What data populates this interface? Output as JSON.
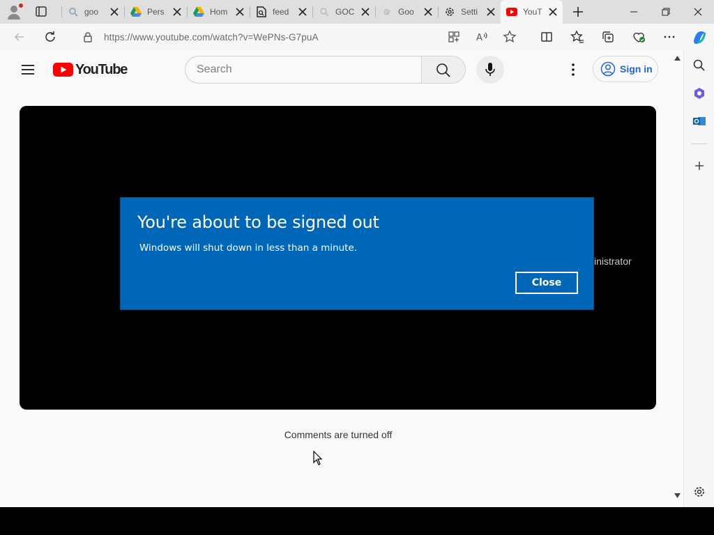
{
  "browser": {
    "tabs": [
      {
        "title": "goo",
        "icon": "google-search-icon"
      },
      {
        "title": "Pers",
        "icon": "google-drive-icon"
      },
      {
        "title": "Hom",
        "icon": "google-drive-icon"
      },
      {
        "title": "feed",
        "icon": "document-search-icon"
      },
      {
        "title": "GOC",
        "icon": "search-icon"
      },
      {
        "title": "Goo",
        "icon": "google-icon"
      },
      {
        "title": "Setti",
        "icon": "gear-icon"
      },
      {
        "title": "YouT",
        "icon": "youtube-icon",
        "active": true
      }
    ],
    "url": "https://www.youtube.com/watch?v=WePNs-G7puA"
  },
  "youtube": {
    "logo_text": "YouTube",
    "search_placeholder": "Search",
    "signin_label": "Sign in",
    "brand_red": "#ff0000",
    "partial_text": "inistrator",
    "comments_text": "Comments are turned off"
  },
  "dialog": {
    "title": "You're about to be signed out",
    "message": "Windows will shut down in less than a minute.",
    "close_label": "Close",
    "background_color": "#0067b8"
  }
}
